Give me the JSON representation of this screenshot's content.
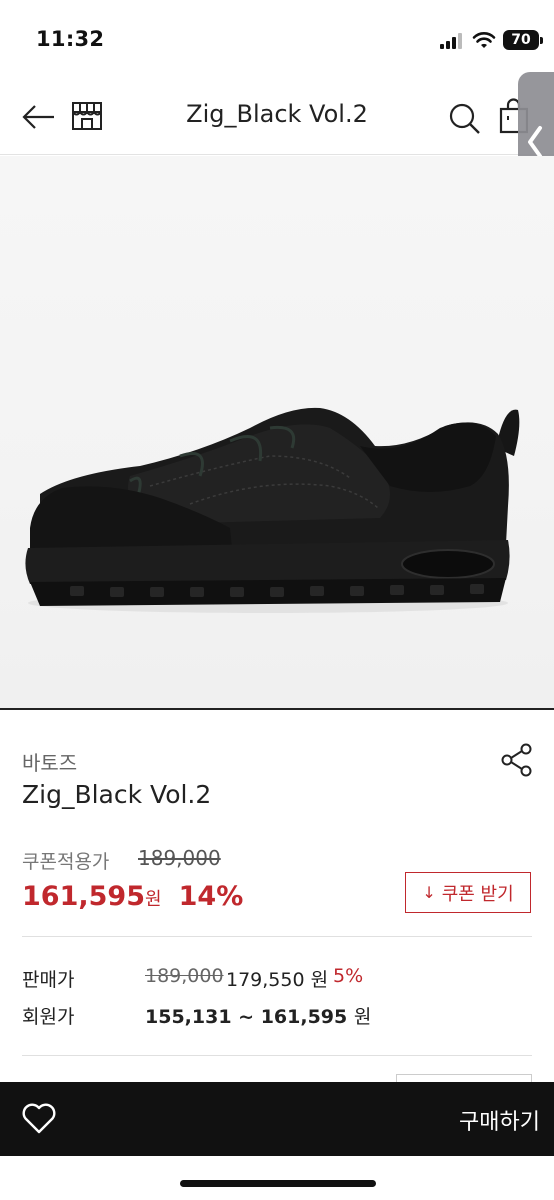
{
  "status_bar": {
    "time": "11:32",
    "battery": "70"
  },
  "nav": {
    "title": "Zig_Black Vol.2",
    "icons": [
      "back-arrow-icon",
      "store-icon",
      "search-icon",
      "cart-icon",
      "chevron-left-icon"
    ]
  },
  "product": {
    "brand": "바토즈",
    "name": "Zig_Black Vol.2",
    "image_alt": "black low-top sneaker"
  },
  "pricing": {
    "coupon_label": "쿠폰적용가",
    "coupon_original": "189,000",
    "coupon_price": "161,595",
    "coupon_unit": "원",
    "coupon_discount": "14%",
    "coupon_button": "쿠폰 받기",
    "coupon_button_icon": "↓",
    "sale_label": "판매가",
    "sale_original": "189,000",
    "sale_price": "179,550 원",
    "sale_discount": "5%",
    "member_label": "회원가",
    "member_price": "155,131 ~ 161,595",
    "member_unit": "원"
  },
  "bottom_bar": {
    "buy_label": "구매하기"
  },
  "colors": {
    "accent_red": "#c0282d",
    "bottom_bar": "#111111",
    "side_tab": "#8e8e93"
  }
}
